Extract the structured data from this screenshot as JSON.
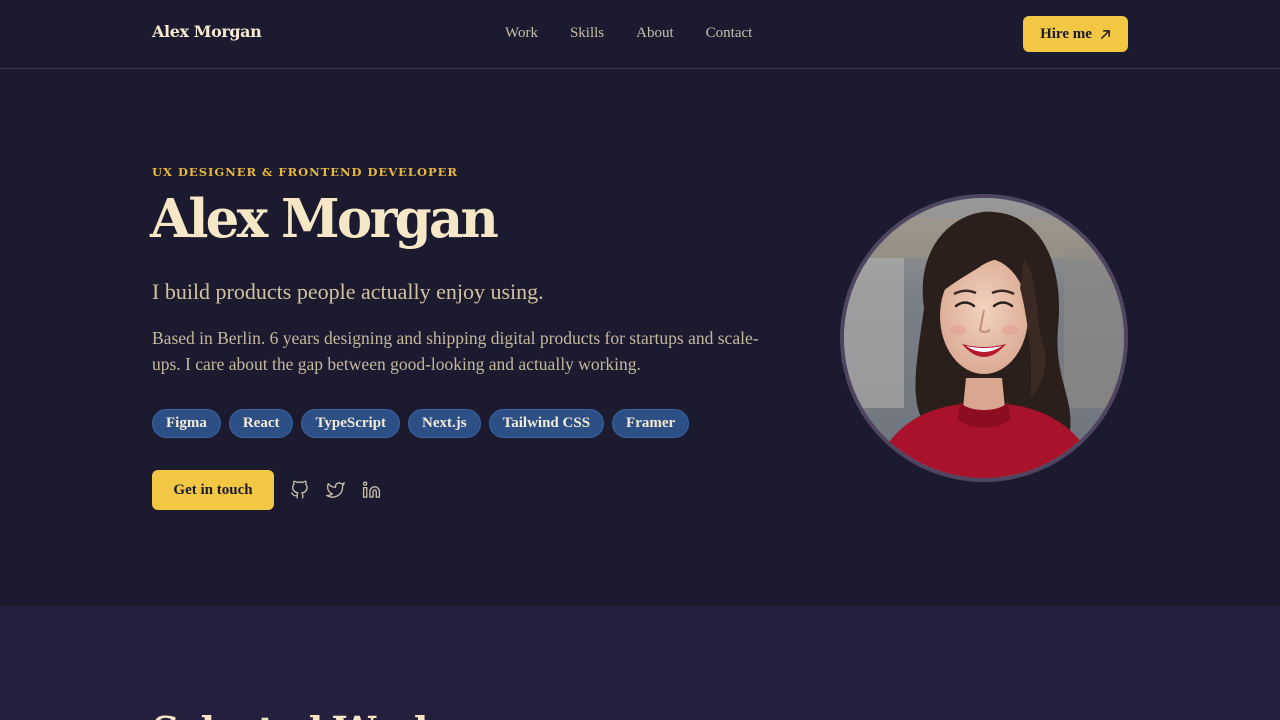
{
  "header": {
    "logo": "Alex Morgan",
    "nav": [
      "Work",
      "Skills",
      "About",
      "Contact"
    ],
    "hire_label": "Hire me"
  },
  "hero": {
    "eyebrow": "UX DESIGNER & FRONTEND DEVELOPER",
    "title": "Alex Morgan",
    "tagline": "I build products people actually enjoy using.",
    "bio": "Based in Berlin. 6 years designing and shipping digital products for startups and scale-ups. I care about the gap between good-looking and actually working.",
    "skills": [
      "Figma",
      "React",
      "TypeScript",
      "Next.js",
      "Tailwind CSS",
      "Framer"
    ],
    "cta_label": "Get in touch",
    "socials": [
      "github-icon",
      "twitter-icon",
      "linkedin-icon"
    ]
  },
  "work": {
    "title": "Selected Work"
  },
  "colors": {
    "background": "#1b1a2e",
    "accent": "#f2c744",
    "tag_bg": "#2c4f86",
    "section_bg": "#251f3e"
  }
}
